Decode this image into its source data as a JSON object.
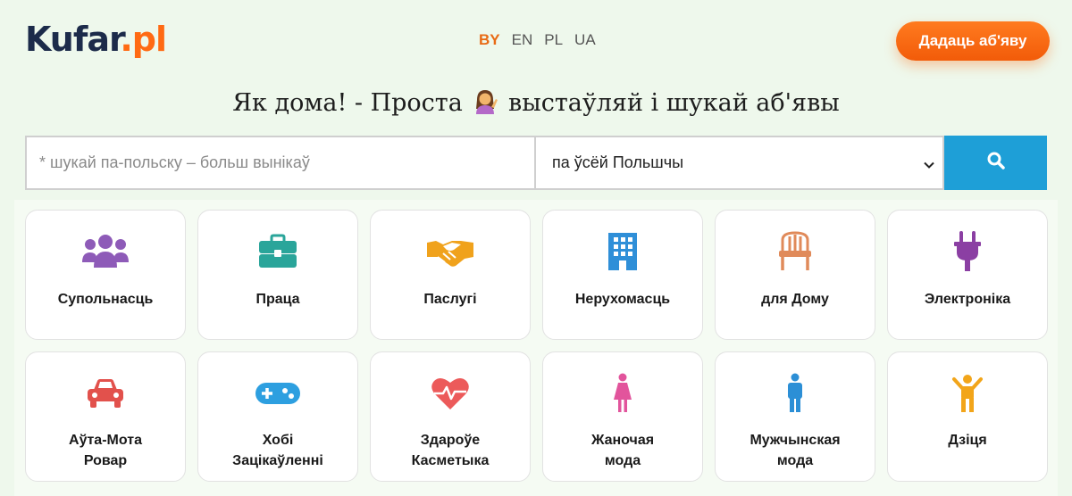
{
  "header": {
    "logo_main": "Kufar",
    "logo_suffix": ".pl",
    "languages": [
      {
        "code": "BY",
        "active": true
      },
      {
        "code": "EN",
        "active": false
      },
      {
        "code": "PL",
        "active": false
      },
      {
        "code": "UA",
        "active": false
      }
    ],
    "post_button": "Дадаць аб'яву"
  },
  "headline": {
    "before": "Як дома! - Проста",
    "after": "выстаўляй і шукай аб'явы",
    "emoji": "person-tipping-hand-icon"
  },
  "search": {
    "placeholder": "* шукай па-польску – больш вынікаў",
    "value": "",
    "region": "па ўсёй Польшчы",
    "button_icon": "search-icon"
  },
  "categories": [
    {
      "label": "Супольнасць",
      "icon": "people-group-icon",
      "color": "#8e5bb8"
    },
    {
      "label": "Праца",
      "icon": "briefcase-icon",
      "color": "#2aa59a"
    },
    {
      "label": "Паслугі",
      "icon": "handshake-icon",
      "color": "#f0a21c"
    },
    {
      "label": "Нерухомасць",
      "icon": "building-icon",
      "color": "#2f8fd8"
    },
    {
      "label": "для Дому",
      "icon": "chair-icon",
      "color": "#e08a5a"
    },
    {
      "label": "Электроніка",
      "icon": "plug-icon",
      "color": "#8b3fa3"
    },
    {
      "label": "Аўта-Мота\nРовар",
      "icon": "car-icon",
      "color": "#e2514c"
    },
    {
      "label": "Хобі\nЗацікаўленні",
      "icon": "gamepad-icon",
      "color": "#2d9fe0"
    },
    {
      "label": "Здароўе\nКасметыка",
      "icon": "heart-pulse-icon",
      "color": "#ec5a5a"
    },
    {
      "label": "Жаночая\nмода",
      "icon": "woman-icon",
      "color": "#e2549c"
    },
    {
      "label": "Мужчынская\nмода",
      "icon": "man-icon",
      "color": "#2c8fd6"
    },
    {
      "label": "Дзіця",
      "icon": "child-icon",
      "color": "#f2a51a"
    }
  ]
}
